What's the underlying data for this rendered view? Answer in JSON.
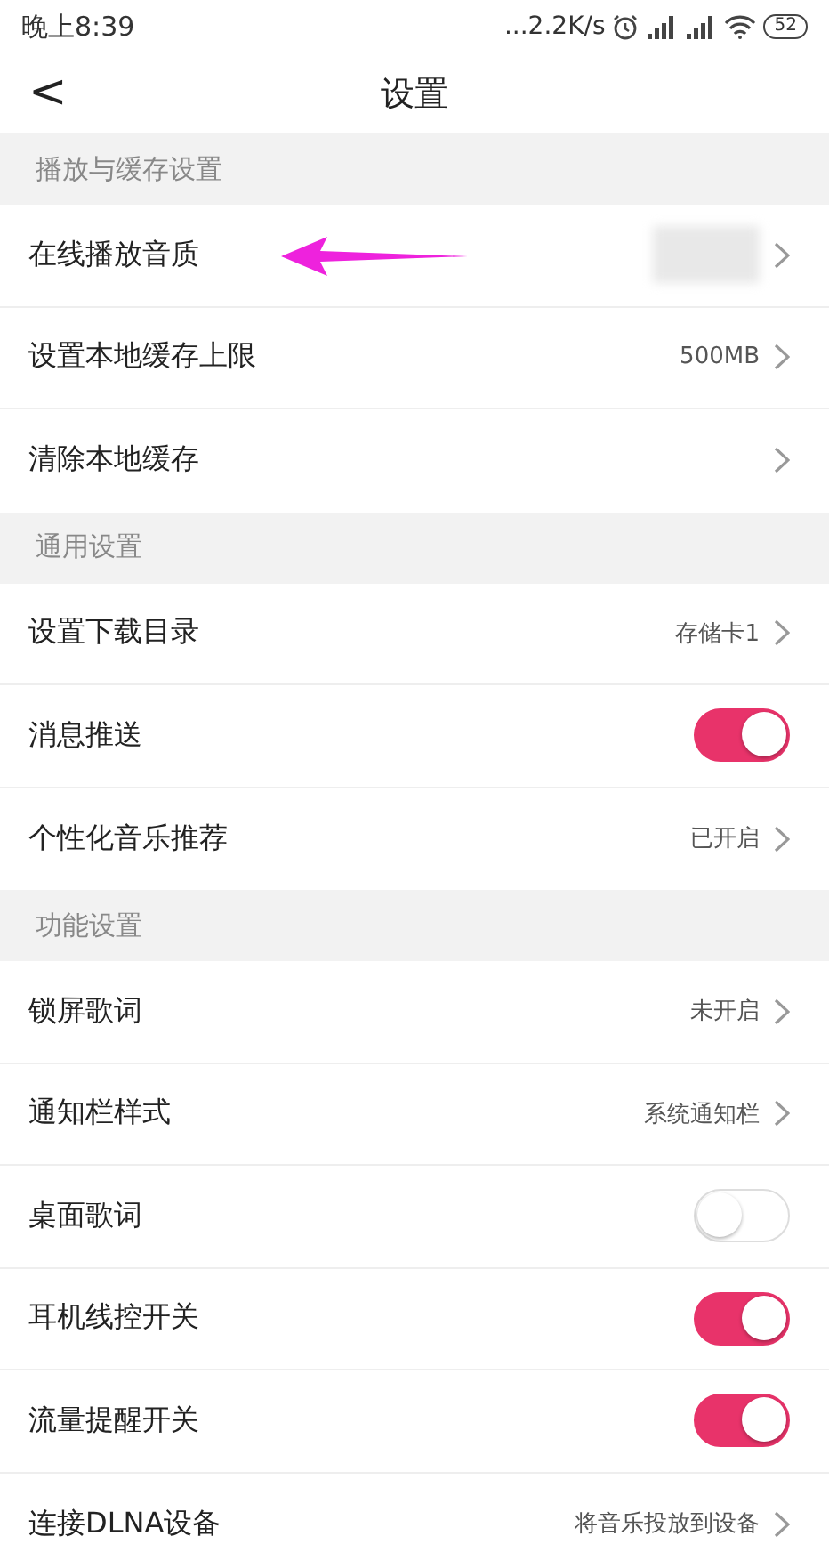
{
  "status_bar": {
    "time": "晚上8:39",
    "speed": "...2.2K/s",
    "battery": "52"
  },
  "header": {
    "back": "<",
    "title": "设置"
  },
  "sections": [
    {
      "title": "播放与缓存设置",
      "rows": [
        {
          "label": "在线播放音质",
          "kind": "masked"
        },
        {
          "label": "设置本地缓存上限",
          "kind": "link",
          "value": "500MB"
        },
        {
          "label": "清除本地缓存",
          "kind": "link"
        }
      ]
    },
    {
      "title": "通用设置",
      "rows": [
        {
          "label": "设置下载目录",
          "kind": "link",
          "value": "存储卡1"
        },
        {
          "label": "消息推送",
          "kind": "toggle",
          "on": true
        },
        {
          "label": "个性化音乐推荐",
          "kind": "link",
          "value": "已开启"
        }
      ]
    },
    {
      "title": "功能设置",
      "rows": [
        {
          "label": "锁屏歌词",
          "kind": "link",
          "value": "未开启"
        },
        {
          "label": "通知栏样式",
          "kind": "link",
          "value": "系统通知栏"
        },
        {
          "label": "桌面歌词",
          "kind": "toggle",
          "on": false
        },
        {
          "label": "耳机线控开关",
          "kind": "toggle",
          "on": true
        },
        {
          "label": "流量提醒开关",
          "kind": "toggle",
          "on": true
        },
        {
          "label": "连接DLNA设备",
          "kind": "link",
          "value": "将音乐投放到设备"
        }
      ]
    }
  ],
  "annotation": {
    "kind": "arrow"
  }
}
